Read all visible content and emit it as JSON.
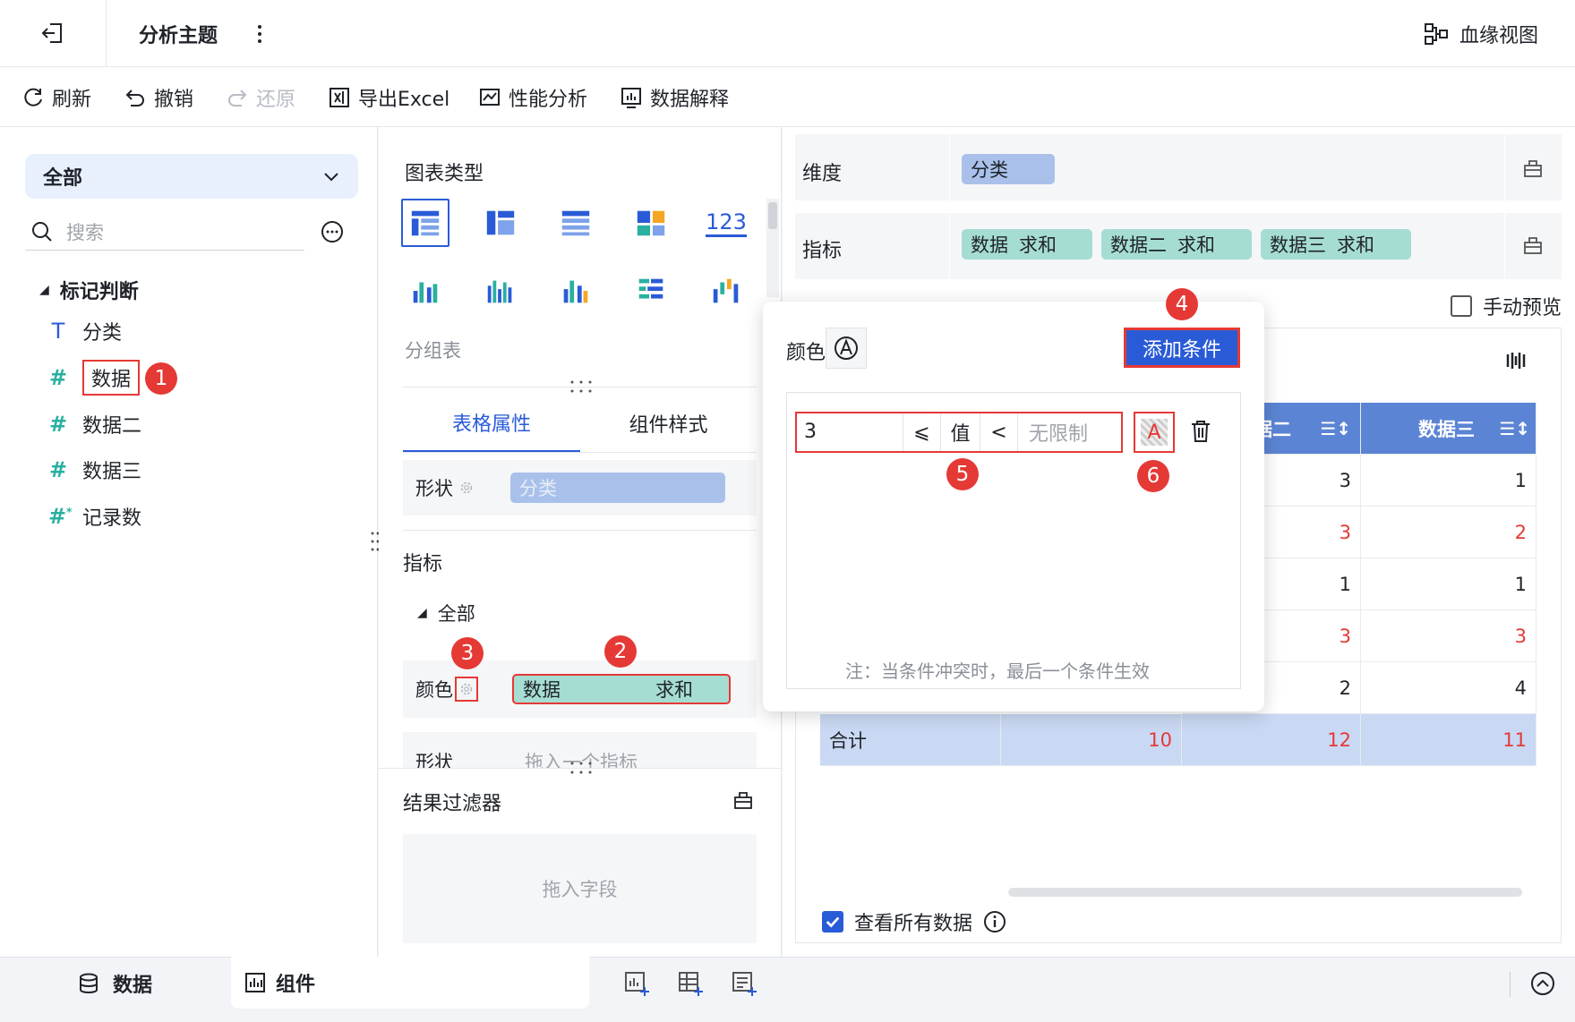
{
  "header": {
    "back_icon": "exit-icon",
    "title": "分析主题",
    "more_icon": "vertical-dots-icon",
    "lineage_label": "血缘视图"
  },
  "toolbar": {
    "refresh": "刷新",
    "undo": "撤销",
    "redo": "还原",
    "export_excel": "导出Excel",
    "perf_analysis": "性能分析",
    "data_explain": "数据解释"
  },
  "left": {
    "scope": "全部",
    "search_placeholder": "搜索",
    "group": "标记判断",
    "fields": [
      {
        "type": "T",
        "name": "分类"
      },
      {
        "type": "#",
        "name": "数据"
      },
      {
        "type": "#",
        "name": "数据二"
      },
      {
        "type": "#",
        "name": "数据三"
      },
      {
        "type": "#*",
        "name": "记录数"
      }
    ]
  },
  "mid": {
    "chart_type_label": "图表类型",
    "selected_chart_name": "分组表",
    "chart_icon_123": "123",
    "tabs": [
      "表格属性",
      "组件样式"
    ],
    "shape_label": "形状",
    "shape_pill": "分类",
    "metrics_label": "指标",
    "all_label": "全部",
    "color_label": "颜色",
    "color_pill_field": "数据",
    "color_pill_agg": "求和",
    "shape_label_2": "形状",
    "shape2_placeholder": "拖入一个指标",
    "result_filter": "结果过滤器",
    "drop_field": "拖入字段"
  },
  "right": {
    "dimension_label": "维度",
    "dimension_pill": "分类",
    "metric_label": "指标",
    "metric_pills": [
      {
        "field": "数据",
        "agg": "求和"
      },
      {
        "field": "数据二",
        "agg": "求和"
      },
      {
        "field": "数据三",
        "agg": "求和"
      }
    ],
    "manual_preview": "手动预览",
    "table": {
      "headers": [
        "据二",
        "数据三"
      ],
      "rows": [
        {
          "c2": "3",
          "c3": "1",
          "c2_red": false,
          "c3_red": false
        },
        {
          "c2": "3",
          "c3": "2",
          "c2_red": true,
          "c3_red": true
        },
        {
          "c2": "1",
          "c3": "1",
          "c2_red": false,
          "c3_red": false
        },
        {
          "c2": "3",
          "c3": "3",
          "c2_red": true,
          "c3_red": true
        },
        {
          "c2": "2",
          "c3": "4",
          "c2_red": false,
          "c3_red": false
        }
      ],
      "total_label": "合计",
      "totals": [
        "10",
        "12",
        "11"
      ]
    },
    "view_all_data": "查看所有数据"
  },
  "popover": {
    "color_label": "颜色",
    "add_condition": "添加条件",
    "condition": {
      "value": "3",
      "op1": "⩽",
      "target": "值",
      "op2": "<",
      "max_placeholder": "无限制",
      "color_letter": "A"
    },
    "note": "注：当条件冲突时，最后一个条件生效"
  },
  "badges": [
    "1",
    "2",
    "3",
    "4",
    "5",
    "6"
  ],
  "bottom": {
    "data_tab": "数据",
    "component_tab": "组件"
  },
  "colors": {
    "accent": "#2a5bd7",
    "annotation_red": "#e53935",
    "pill_blue": "#a9c1ea",
    "pill_green": "#a6ddd3",
    "table_header": "#5b84d4"
  }
}
